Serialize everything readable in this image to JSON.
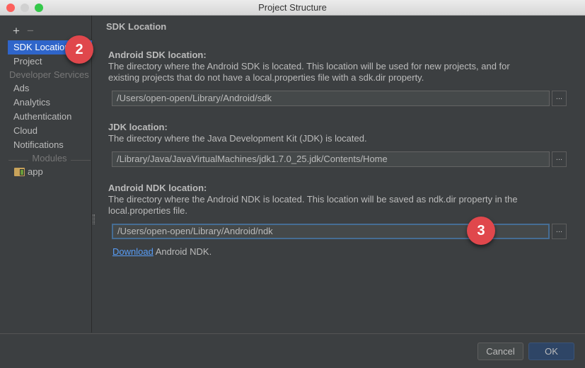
{
  "window": {
    "title": "Project Structure"
  },
  "sidebar": {
    "add": "+",
    "remove": "−",
    "items": [
      {
        "label": "SDK Location"
      },
      {
        "label": "Project"
      }
    ],
    "section": "Developer Services",
    "services": [
      "Ads",
      "Analytics",
      "Authentication",
      "Cloud",
      "Notifications"
    ],
    "modules_header": "Modules",
    "modules": [
      "app"
    ]
  },
  "main": {
    "title": "SDK Location",
    "sdk": {
      "label": "Android SDK location:",
      "desc1": "The directory where the Android SDK is located. This location will be used for new projects, and for",
      "desc2": "existing projects that do not have a local.properties file with a sdk.dir property.",
      "value": "/Users/open-open/Library/Android/sdk"
    },
    "jdk": {
      "label": "JDK location:",
      "desc1": "The directory where the Java Development Kit (JDK) is located.",
      "value": "/Library/Java/JavaVirtualMachines/jdk1.7.0_25.jdk/Contents/Home"
    },
    "ndk": {
      "label": "Android NDK location:",
      "desc1": "The directory where the Android NDK is located. This location will be saved as ndk.dir property in the",
      "desc2": "local.properties file.",
      "value": "/Users/open-open/Library/Android/ndk"
    },
    "download_link": "Download",
    "download_text": " Android NDK.",
    "browse": "..."
  },
  "badges": [
    "2",
    "3"
  ],
  "buttons": {
    "cancel": "Cancel",
    "ok": "OK"
  }
}
